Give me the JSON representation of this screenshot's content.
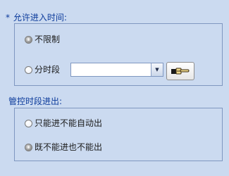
{
  "allow_time": {
    "required_marker": "*",
    "title": "允许进入时间:",
    "options": {
      "unlimited": "不限制",
      "time_period": "分时段"
    },
    "time_period_select": {
      "value": ""
    },
    "pick_button": {
      "icon": "hand-pointer-icon"
    }
  },
  "control_period": {
    "title": "管控时段进出:",
    "options": {
      "exit_only": "只能进不能自动出",
      "no_in_no_out": "既不能进也不能出"
    }
  },
  "colors": {
    "background": "#cbdaf0",
    "title_text": "#0b3a9b",
    "group_border": "#7f97c0"
  }
}
